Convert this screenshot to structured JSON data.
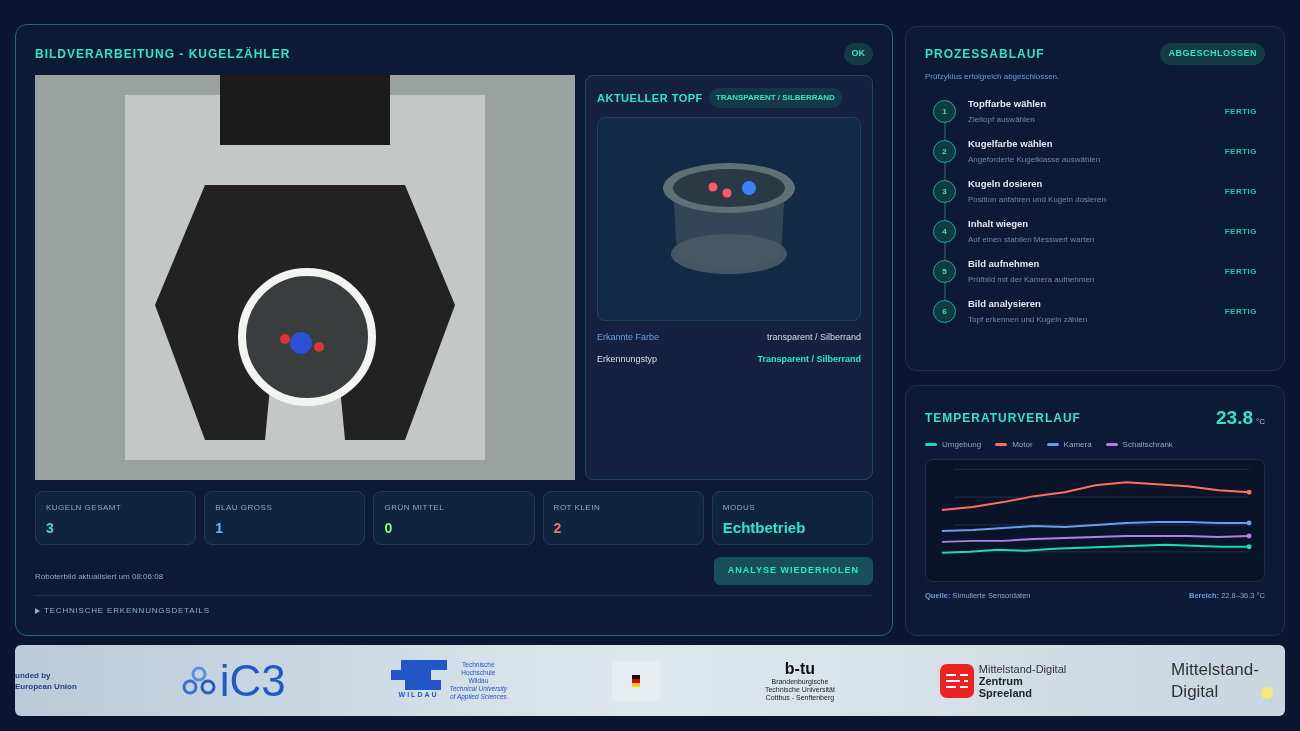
{
  "vision": {
    "title": "BILDVERARBEITUNG - KUGELZÄHLER",
    "status": "OK",
    "current_pot": {
      "title": "AKTUELLER TOPF",
      "badge": "TRANSPARENT / SILBERRAND",
      "details": [
        {
          "label": "Erkannte Farbe",
          "value": "transparent / Silberrand",
          "kind": "plain"
        },
        {
          "label": "Erkennungstyp",
          "value": "Transparent / Silberrand",
          "kind": "accent"
        }
      ]
    },
    "stats": [
      {
        "label": "KUGELN GESAMT",
        "value": "3",
        "color": "#2ee6c5"
      },
      {
        "label": "BLAU GROSS",
        "value": "1",
        "color": "#6cb8ff"
      },
      {
        "label": "GRÜN MITTEL",
        "value": "0",
        "color": "#8ef58a"
      },
      {
        "label": "ROT KLEIN",
        "value": "2",
        "color": "#ff6b6b"
      },
      {
        "label": "MODUS",
        "value": "Echtbetrieb",
        "color": "#2ee6c5"
      }
    ],
    "updated": "Roboterbild aktualisiert um 08:06:08",
    "button": "ANALYSE WIEDERHOLEN",
    "details_toggle": {
      "label": "TECHNISCHE ERKENNUNGSDETAILS",
      "expanded": false
    }
  },
  "process": {
    "title": "PROZESSABLAUF",
    "badge": "ABGESCHLOSSEN",
    "message": "Prüfzyklus erfolgreich abgeschlossen.",
    "steps": [
      {
        "number": "1",
        "title": "Topffarbe wählen",
        "subtitle": "Zieltopf auswählen",
        "status": "FERTIG",
        "done": true
      },
      {
        "number": "2",
        "title": "Kugelfarbe wählen",
        "subtitle": "Angeforderte Kugelklasse auswählen",
        "status": "FERTIG",
        "done": true
      },
      {
        "number": "3",
        "title": "Kugeln dosieren",
        "subtitle": "Position anfahren und Kugeln dosieren",
        "status": "FERTIG",
        "done": true
      },
      {
        "number": "4",
        "title": "Inhalt wiegen",
        "subtitle": "Auf einen stabilen Messwert warten",
        "status": "FERTIG",
        "done": true
      },
      {
        "number": "5",
        "title": "Bild aufnehmen",
        "subtitle": "Prüfbild mit der Kamera aufnehmen",
        "status": "FERTIG",
        "done": true
      },
      {
        "number": "6",
        "title": "Bild analysieren",
        "subtitle": "Topf erkennen und Kugeln zählen",
        "status": "FERTIG",
        "done": true
      }
    ]
  },
  "temperature": {
    "title": "TEMPERATURVERLAUF",
    "value": "23.8",
    "unit": "°C",
    "legend": [
      {
        "name": "Umgebung",
        "color": "#1fd8b5"
      },
      {
        "name": "Motor",
        "color": "#ff6f5b"
      },
      {
        "name": "Kamera",
        "color": "#6a9cf5"
      },
      {
        "name": "Schaltschrank",
        "color": "#b57cf0"
      }
    ],
    "source_label": "Quelle:",
    "source": "Simulierte Sensordaten",
    "range_label": "Bereich:",
    "range": "22.8–36.3 °C"
  },
  "footer": {
    "eu": [
      "unded by",
      "European Union"
    ],
    "ic3": "iC3",
    "thw": {
      "mark": "WILDAU",
      "lines": [
        "Technische",
        "Hochschule",
        "Wildau"
      ],
      "english": [
        "Technical University",
        "of Applied Sciences"
      ]
    },
    "btu": {
      "mark": "b-tu",
      "lines": [
        "Brandenburgische",
        "Technische Universität",
        "Cottbus - Senftenberg"
      ]
    },
    "zentrum": [
      "Mittelstand-Digital",
      "Zentrum",
      "Spreeland"
    ],
    "md": [
      "Mittelstand-",
      "Digital"
    ]
  }
}
